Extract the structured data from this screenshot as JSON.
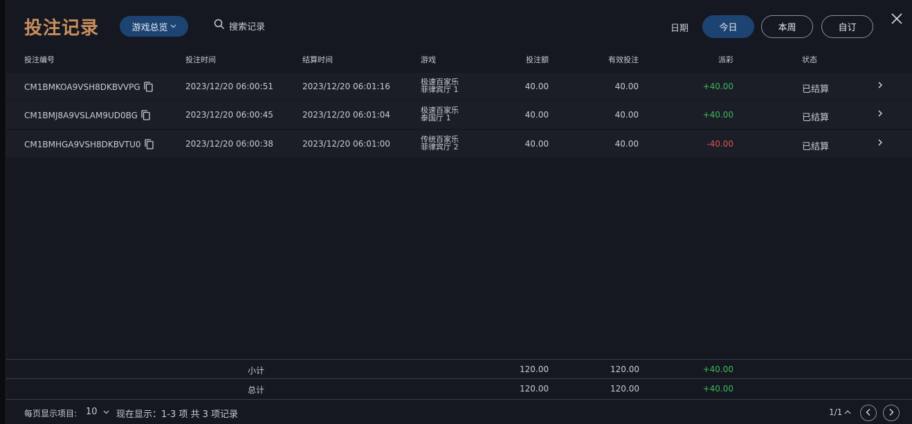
{
  "header": {
    "title": "投注记录",
    "game_filter": "游戏总览",
    "search_placeholder": "搜索记录",
    "date_label": "日期",
    "date_options": [
      "今日",
      "本周",
      "自订"
    ]
  },
  "table": {
    "columns": [
      "投注编号",
      "投注时间",
      "结算时间",
      "游戏",
      "投注额",
      "有效投注",
      "派彩",
      "状态"
    ],
    "rows": [
      {
        "id": "CM1BMKOA9VSH8DKBVVPG",
        "bet_time": "2023/12/20 06:00:51",
        "settle_time": "2023/12/20 06:01:16",
        "game_line1": "极速百家乐",
        "game_line2": "菲律宾厅 1",
        "amount": "40.00",
        "valid": "40.00",
        "payout": "+40.00",
        "status": "已结算"
      },
      {
        "id": "CM1BMJ8A9VSLAM9UD0BG",
        "bet_time": "2023/12/20 06:00:45",
        "settle_time": "2023/12/20 06:01:04",
        "game_line1": "极速百家乐",
        "game_line2": "泰国厅 1",
        "amount": "40.00",
        "valid": "40.00",
        "payout": "+40.00",
        "status": "已结算"
      },
      {
        "id": "CM1BMHGA9VSH8DKBVTU0",
        "bet_time": "2023/12/20 06:00:38",
        "settle_time": "2023/12/20 06:01:00",
        "game_line1": "传统百家乐",
        "game_line2": "菲律宾厅 2",
        "amount": "40.00",
        "valid": "40.00",
        "payout": "-40.00",
        "status": "已结算"
      }
    ]
  },
  "summary": {
    "subtotal_label": "小计",
    "subtotal_amount": "120.00",
    "subtotal_valid": "120.00",
    "subtotal_payout": "+40.00",
    "total_label": "总计",
    "total_amount": "120.00",
    "total_valid": "120.00",
    "total_payout": "+40.00"
  },
  "footer": {
    "per_page_label": "每页显示项目:",
    "per_page_value": "10",
    "showing_text": "现在显示：1-3 项 共 3 项记录",
    "page_indicator": "1/1"
  },
  "colors": {
    "accent": "#1d4373",
    "title": "#c98f5e",
    "positive": "#3cb95a",
    "negative": "#e05353"
  },
  "icons": [
    "chevron-down-icon",
    "search-icon",
    "close-icon",
    "copy-icon",
    "chevron-right-icon",
    "chevron-up-icon",
    "chevron-left-icon"
  ]
}
